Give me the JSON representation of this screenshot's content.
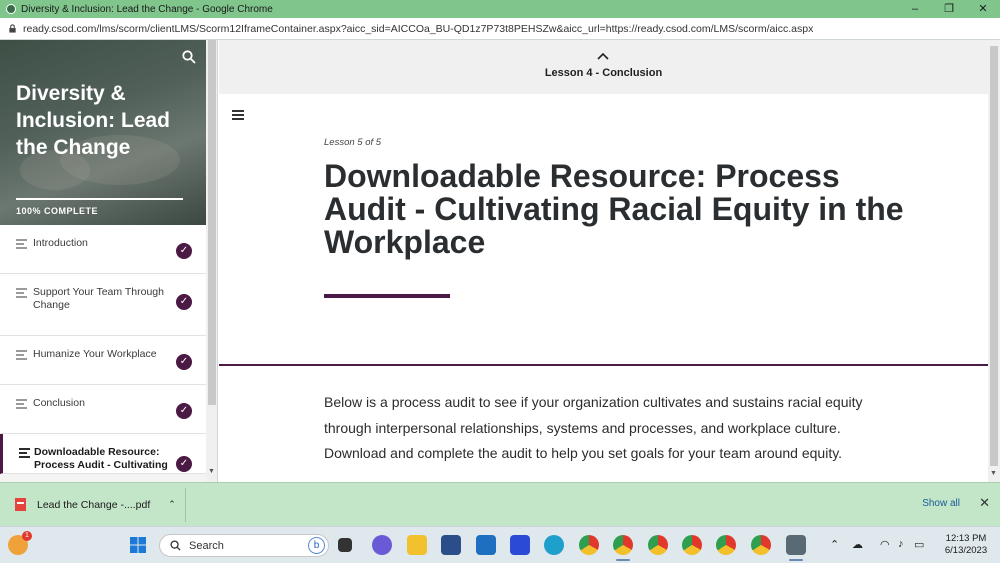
{
  "window": {
    "title": "Diversity & Inclusion: Lead the Change - Google Chrome",
    "controls": [
      "–",
      "❐",
      "✕"
    ]
  },
  "address": {
    "url": "ready.csod.com/lms/scorm/clientLMS/Scorm12IframeContainer.aspx?aicc_sid=AICCOa_BU-QD1z7P73t8PEHSZw&aicc_url=https://ready.csod.com/LMS/scorm/aicc.aspx"
  },
  "sidebar": {
    "course_title": "Diversity & Inclusion: Lead the Change",
    "progress_label": "100% COMPLETE",
    "progress_fraction": 1.0,
    "lessons": [
      {
        "label": "Introduction",
        "completed": true
      },
      {
        "label": "Support Your Team Through Change",
        "completed": true
      },
      {
        "label": "Humanize Your Workplace",
        "completed": true
      },
      {
        "label": "Conclusion",
        "completed": true
      },
      {
        "label": "Downloadable Resource: Process Audit - Cultivating",
        "completed": true,
        "active": true
      }
    ]
  },
  "main": {
    "lesson_nav_label": "Lesson 4 - Conclusion",
    "lesson_number": "Lesson 5 of 5",
    "heading": "Downloadable Resource: Process Audit - Cultivating Racial Equity in the Workplace",
    "body": "Below is a process audit to see if your organization cultivates and sustains racial equity through interpersonal relationships, systems and processes, and workplace culture. Download and complete the audit to help you set goals for your team around equity."
  },
  "downloads": {
    "file_name": "Lead the Change -....pdf",
    "show_all": "Show all"
  },
  "taskbar": {
    "search_placeholder": "Search",
    "notification_count": "1",
    "time": "12:13 PM",
    "date": "6/13/2023",
    "accent_color": "#4a1a44"
  }
}
